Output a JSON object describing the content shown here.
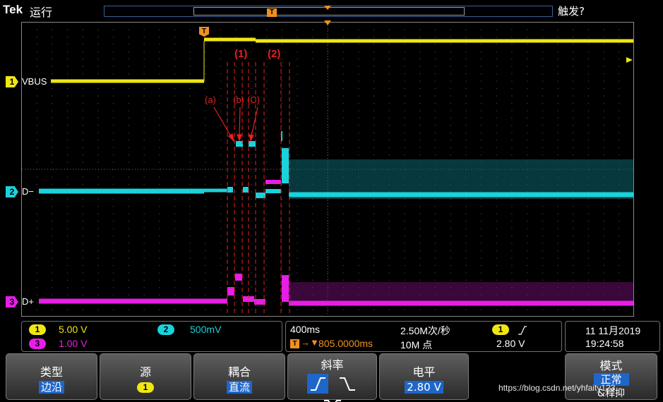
{
  "header": {
    "brand": "Tek",
    "run_state": "运行",
    "trigger_state": "触发?",
    "trigger_marker": "T"
  },
  "channels": [
    {
      "id": "1",
      "label": "VBUS",
      "color": "#f0e614"
    },
    {
      "id": "2",
      "label": "D−",
      "color": "#19d3dc"
    },
    {
      "id": "3",
      "label": "D+",
      "color": "#e61ee6"
    }
  ],
  "annotations": {
    "group1": "(1)",
    "group2": "(2)",
    "a": "(a)",
    "b": "(b)",
    "c": "(C)"
  },
  "vertical_settings": {
    "ch1_scale": "5.00 V",
    "ch2_scale": "500mV",
    "ch3_scale": "1.00 V"
  },
  "horizontal": {
    "timebase": "400ms",
    "sample_rate": "2.50M次/秒",
    "delay": "805.0000ms",
    "record_length": "10M 点",
    "delay_icon": "T"
  },
  "trigger": {
    "source": "1",
    "slope_icon": "rising-slope-icon",
    "level": "2.80 V"
  },
  "datetime": {
    "date": "11 11月2019",
    "time": "19:24:58"
  },
  "menu": {
    "type": {
      "title": "类型",
      "value": "边沿"
    },
    "source": {
      "title": "源",
      "value": "1"
    },
    "coupling": {
      "title": "耦合",
      "value": "直流"
    },
    "slope": {
      "title": "斜率",
      "options": [
        "rising",
        "falling",
        "either"
      ],
      "selected": "rising"
    },
    "level": {
      "title": "电平",
      "value": "2.80 V"
    },
    "mode": {
      "title": "模式",
      "value": "正常",
      "extra": "&释抑"
    }
  },
  "watermark": "https://blog.csdn.net/yhfaity123",
  "colors": {
    "ch1": "#f0e614",
    "ch2": "#19d3dc",
    "ch3": "#e61ee6",
    "annotation": "#e62020",
    "highlight": "#1f66c9"
  }
}
